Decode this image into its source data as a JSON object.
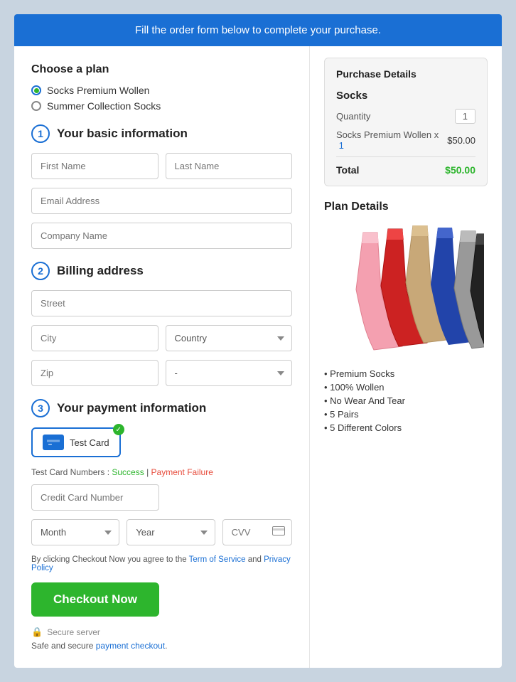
{
  "banner": {
    "text": "Fill the order form below to complete your purchase."
  },
  "left": {
    "choose_plan_label": "Choose a plan",
    "plan_options": [
      {
        "id": "socks-premium",
        "label": "Socks Premium Wollen",
        "selected": true
      },
      {
        "id": "summer-collection",
        "label": "Summer Collection Socks",
        "selected": false
      }
    ],
    "section1": {
      "number": "1",
      "title": "Your basic information",
      "fields": {
        "first_name_placeholder": "First Name",
        "last_name_placeholder": "Last Name",
        "email_placeholder": "Email Address",
        "company_placeholder": "Company Name"
      }
    },
    "section2": {
      "number": "2",
      "title": "Billing address",
      "fields": {
        "street_placeholder": "Street",
        "city_placeholder": "City",
        "country_placeholder": "Country",
        "zip_placeholder": "Zip",
        "state_placeholder": "-"
      }
    },
    "section3": {
      "number": "3",
      "title": "Your payment information",
      "card_label": "Test Card",
      "test_card_label": "Test Card Numbers : ",
      "success_label": "Success",
      "failure_label": "Payment Failure",
      "credit_number_placeholder": "Credit Card Number",
      "month_placeholder": "Month",
      "year_placeholder": "Year",
      "cvv_placeholder": "CVV",
      "terms_text_before": "By clicking Checkout Now you agree to the ",
      "terms_link1": "Term of Service",
      "terms_text_mid": " and ",
      "terms_link2": "Privacy Policy",
      "checkout_label": "Checkout Now",
      "secure_label": "Secure server",
      "safe_text_before": "Safe and secure payment checkout",
      "safe_link": "payment checkout"
    }
  },
  "right": {
    "purchase_details": {
      "title": "Purchase Details",
      "product": "Socks",
      "quantity_label": "Quantity",
      "quantity_value": "1",
      "item_label": "Socks Premium Wollen x",
      "item_x": "1",
      "item_price": "$50.00",
      "total_label": "Total",
      "total_price": "$50.00"
    },
    "plan_details": {
      "title": "Plan Details",
      "features": [
        "Premium Socks",
        "100% Wollen",
        "No Wear And Tear",
        "5 Pairs",
        "5 Different Colors"
      ]
    }
  }
}
